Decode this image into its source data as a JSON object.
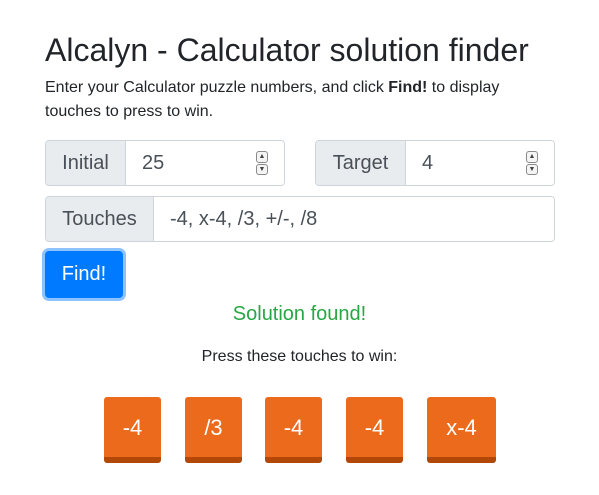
{
  "title": "Alcalyn - Calculator solution finder",
  "intro": {
    "before": "Enter your Calculator puzzle numbers, and click ",
    "bold": "Find!",
    "after": " to display touches to press to win."
  },
  "initial": {
    "label": "Initial",
    "value": "25"
  },
  "target": {
    "label": "Target",
    "value": "4"
  },
  "touches": {
    "label": "Touches",
    "value": "-4, x-4, /3, +/-, /8"
  },
  "find_button": {
    "label": "Find!"
  },
  "status": {
    "text": "Solution found!",
    "color": "#28a745"
  },
  "instruction": "Press these touches to win:",
  "solution_keys": [
    "-4",
    "/3",
    "-4",
    "-4",
    "x-4"
  ],
  "colors": {
    "accent": "#007bff",
    "key": "#ec6a1b",
    "key_shadow": "#b24808"
  }
}
